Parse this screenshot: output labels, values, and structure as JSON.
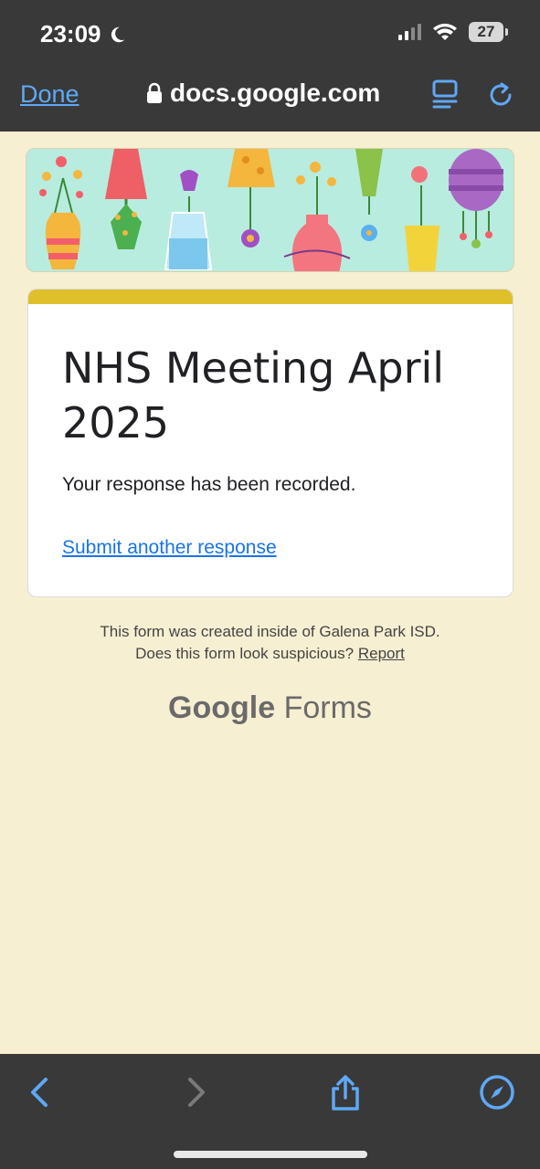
{
  "status_bar": {
    "time": "23:09",
    "battery": "27",
    "icons": [
      "moon-icon",
      "signal-icon",
      "wifi-icon",
      "battery-icon"
    ]
  },
  "browser": {
    "done_label": "Done",
    "url": "docs.google.com",
    "icons": [
      "lock-icon",
      "reader-icon",
      "reload-icon"
    ]
  },
  "form": {
    "title": "NHS Meeting April 2025",
    "confirmation": "Your response has been recorded.",
    "submit_another_label": "Submit another response",
    "accent_color": "#e0c02a"
  },
  "footer": {
    "line1": "This form was created inside of Galena Park ISD.",
    "line2_prefix": "Does this form look suspicious?",
    "report_label": "Report",
    "brand_google": "Google",
    "brand_forms": "Forms"
  },
  "toolbar": {
    "icons": [
      "back-icon",
      "forward-icon",
      "share-icon",
      "compass-icon"
    ]
  },
  "colors": {
    "background": "#f7efd2",
    "chrome": "#393939",
    "link_blue": "#1a73e8",
    "ios_blue": "#5fa8f5"
  }
}
